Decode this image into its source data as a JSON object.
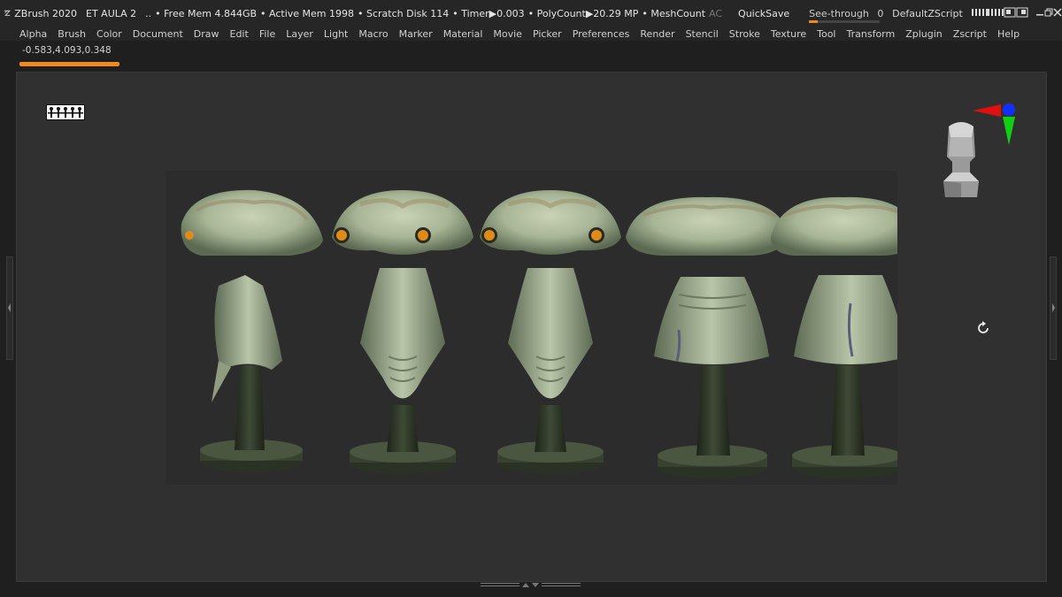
{
  "titlebar": {
    "app": "ZBrush 2020",
    "document": "ET AULA 2",
    "sep": "..",
    "free_mem": "• Free Mem 4.844GB",
    "active_mem": "• Active Mem 1998",
    "scratch": "• Scratch Disk 114",
    "timer": "• Timer▶0.003",
    "polycount": "• PolyCount▶20.29 MP",
    "meshcount": "• MeshCount",
    "ac": "AC",
    "quicksave": "QuickSave",
    "seethrough": "See-through",
    "seethrough_value": "0",
    "default_script": "DefaultZScript"
  },
  "menu": [
    "Alpha",
    "Brush",
    "Color",
    "Document",
    "Draw",
    "Edit",
    "File",
    "Layer",
    "Light",
    "Macro",
    "Marker",
    "Material",
    "Movie",
    "Picker",
    "Preferences",
    "Render",
    "Stencil",
    "Stroke",
    "Texture",
    "Tool",
    "Transform",
    "Zplugin",
    "Zscript",
    "Help"
  ],
  "status": {
    "coordinates": "-0.583,4.093,0.348"
  },
  "colors": {
    "accent": "#f08a1c",
    "axis_x": "#e01010",
    "axis_y": "#10d010",
    "axis_z": "#1030ff"
  },
  "icons": [
    "zbrush-logo-icon",
    "minimize-icon",
    "restore-icon",
    "close-icon",
    "gizmo-icon",
    "head-view-icon",
    "rotate-icon"
  ]
}
